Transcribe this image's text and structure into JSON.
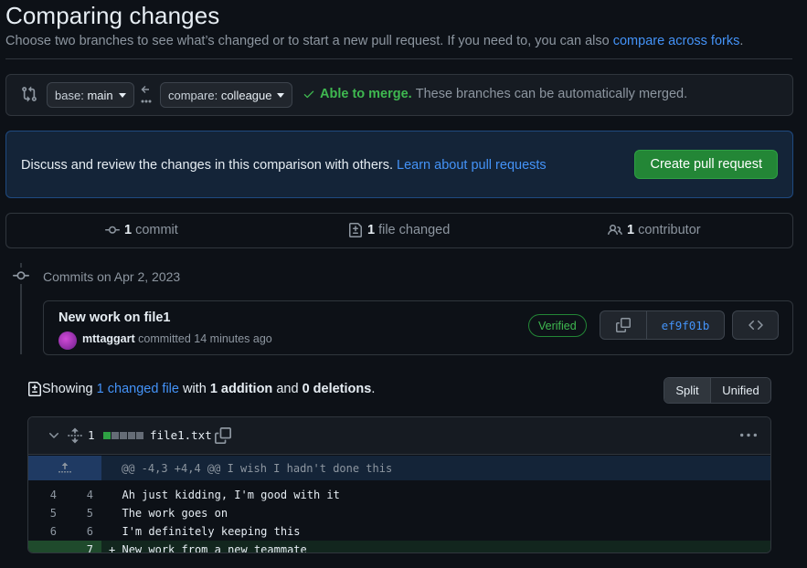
{
  "header": {
    "title": "Comparing changes",
    "subtitle_prefix": "Choose two branches to see what’s changed or to start a new pull request. If you need to, you can also ",
    "subtitle_link": "compare across forks",
    "subtitle_suffix": "."
  },
  "range": {
    "base_label": "base:",
    "base_value": "main",
    "compare_label": "compare:",
    "compare_value": "colleague",
    "merge_status": "Able to merge.",
    "merge_detail": "These branches can be automatically merged."
  },
  "blankslate": {
    "text": "Discuss and review the changes in this comparison with others.",
    "link": "Learn about pull requests",
    "button": "Create pull request"
  },
  "summary": {
    "commits_count": "1",
    "commits_label": "commit",
    "files_count": "1",
    "files_label": "file changed",
    "contributors_count": "1",
    "contributors_label": "contributor"
  },
  "commits": {
    "group_label": "Commits on Apr 2, 2023",
    "items": [
      {
        "title": "New work on file1",
        "author": "mttaggart",
        "action": "committed",
        "time": "14 minutes ago",
        "badge": "Verified",
        "sha": "ef9f01b"
      }
    ]
  },
  "diff_summary": {
    "prefix": "Showing",
    "files_link": "1 changed file",
    "with": "with",
    "additions": "1 addition",
    "and": "and",
    "deletions": "0 deletions",
    "suffix": ".",
    "view_split": "Split",
    "view_unified": "Unified"
  },
  "file": {
    "change_count": "1",
    "name": "file1.txt",
    "diffstat": [
      "added",
      "neutral",
      "neutral",
      "neutral",
      "neutral"
    ],
    "hunk_header": "@@ -4,3 +4,4 @@ I wish I hadn't done this",
    "lines": [
      {
        "old": "4",
        "new": "4",
        "marker": " ",
        "text": "Ah just kidding, I'm good with it",
        "type": "context"
      },
      {
        "old": "5",
        "new": "5",
        "marker": " ",
        "text": "The work goes on",
        "type": "context"
      },
      {
        "old": "6",
        "new": "6",
        "marker": " ",
        "text": "I'm definitely keeping this",
        "type": "context"
      },
      {
        "old": "",
        "new": "7",
        "marker": "+",
        "text": "New work from a new teammate",
        "type": "add"
      }
    ]
  },
  "colors": {
    "success": "#3fb950",
    "link": "#4493f8",
    "primary_button": "#238636",
    "background": "#0d1117"
  }
}
